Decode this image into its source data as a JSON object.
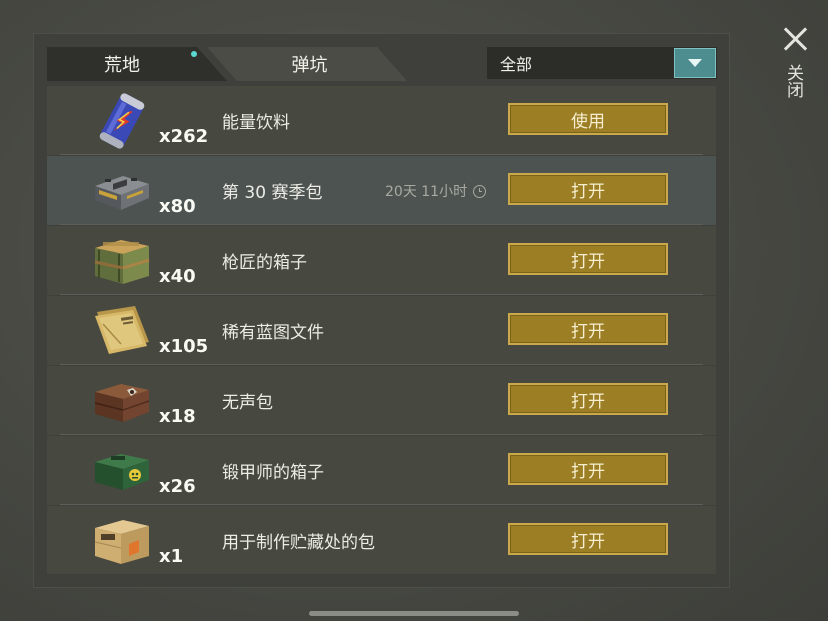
{
  "tabs": [
    {
      "label": "荒地",
      "active": true,
      "has_dot": true
    },
    {
      "label": "弹坑",
      "active": false
    }
  ],
  "filter": {
    "value": "全部",
    "icon": "dropdown-triangle-icon",
    "accent": "#4d8d8f"
  },
  "close": {
    "label": "关闭",
    "icon": "close-x-icon"
  },
  "colors": {
    "button": "#9c7e25",
    "button_border": "#c9a94c",
    "dot": "#5dd8d0"
  },
  "items": [
    {
      "icon": "energy-drink-can-icon",
      "quantity": "x262",
      "name": "能量饮料",
      "action": "使用",
      "timer": ""
    },
    {
      "icon": "season-pack-case-icon",
      "quantity": "x80",
      "name": "第 30 赛季包",
      "action": "打开",
      "timer": "20天 11小时"
    },
    {
      "icon": "gunsmith-crate-icon",
      "quantity": "x40",
      "name": "枪匠的箱子",
      "action": "打开",
      "timer": ""
    },
    {
      "icon": "blueprint-folder-icon",
      "quantity": "x105",
      "name": "稀有蓝图文件",
      "action": "打开",
      "timer": ""
    },
    {
      "icon": "silent-pack-crate-icon",
      "quantity": "x18",
      "name": "无声包",
      "action": "打开",
      "timer": ""
    },
    {
      "icon": "armorer-box-icon",
      "quantity": "x26",
      "name": "锻甲师的箱子",
      "action": "打开",
      "timer": ""
    },
    {
      "icon": "stash-pack-box-icon",
      "quantity": "x1",
      "name": "用于制作贮藏处的包",
      "action": "打开",
      "timer": ""
    }
  ]
}
